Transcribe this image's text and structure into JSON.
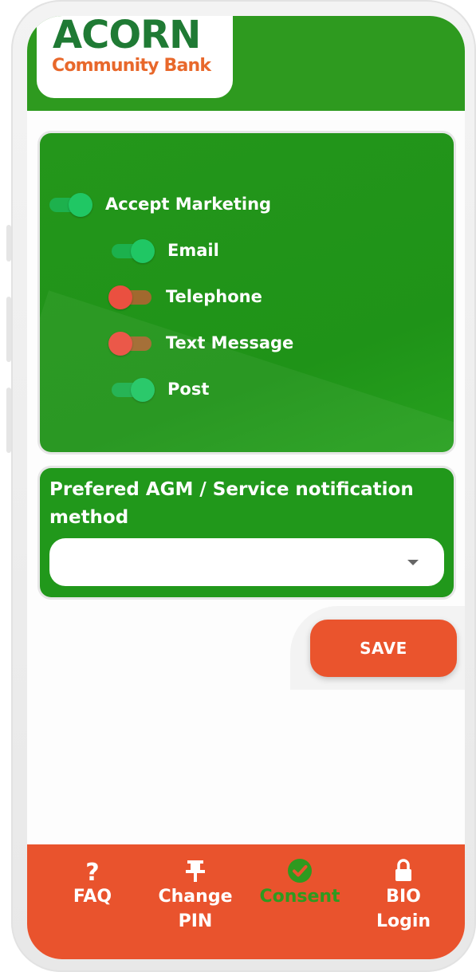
{
  "header": {
    "logo_title": "ACORN",
    "logo_subtitle": "Community Bank",
    "brand_green": "#2e9a1f",
    "brand_orange": "#e9532d"
  },
  "marketing": {
    "toggles": [
      {
        "label": "Accept Marketing",
        "on": true
      },
      {
        "label": "Email",
        "on": true
      },
      {
        "label": "Telephone",
        "on": false
      },
      {
        "label": "Text Message",
        "on": false
      },
      {
        "label": "Post",
        "on": true
      }
    ]
  },
  "notification": {
    "label": "Prefered AGM / Service notification method",
    "selected_value": "",
    "dropdown_icon": "caret-down-icon"
  },
  "actions": {
    "save_label": "SAVE"
  },
  "bottom_nav": {
    "items": [
      {
        "label": "FAQ",
        "icon": "question-icon",
        "active": false
      },
      {
        "label": "Change\nPIN",
        "label_line1": "Change",
        "label_line2": "PIN",
        "icon": "pin-icon",
        "active": false
      },
      {
        "label": "Consent",
        "icon": "check-circle-icon",
        "active": true
      },
      {
        "label_line1": "BIO",
        "label_line2": "Login",
        "icon": "lock-icon",
        "active": false
      }
    ]
  }
}
